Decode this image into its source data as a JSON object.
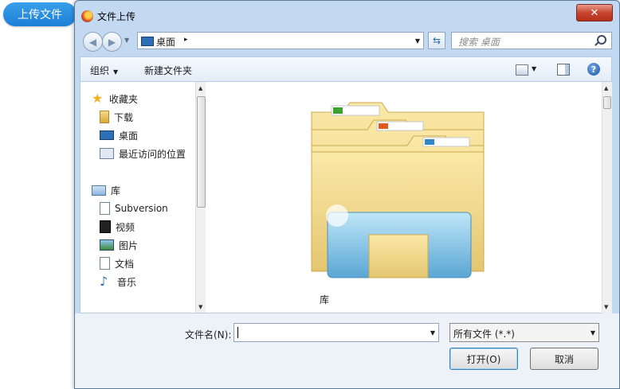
{
  "page_button": {
    "label": "上传文件"
  },
  "dialog": {
    "title": "文件上传",
    "close_label": "✕",
    "address": {
      "location": "桌面",
      "separator": "▸"
    },
    "search_placeholder": "搜索 桌面",
    "toolbar": {
      "organize": "组织",
      "new_folder": "新建文件夹",
      "help": "?"
    },
    "nav": {
      "favorites": "收藏夹",
      "downloads": "下载",
      "desktop": "桌面",
      "recent": "最近访问的位置",
      "libraries": "库",
      "subversion": "Subversion",
      "videos": "视频",
      "pictures": "图片",
      "documents": "文档",
      "music": "音乐"
    },
    "content": {
      "item_label": "库"
    },
    "filename": {
      "label": "文件名(N):",
      "value": ""
    },
    "filetype": {
      "value": "所有文件 (*.*)"
    },
    "buttons": {
      "open": "打开(O)",
      "cancel": "取消"
    }
  }
}
